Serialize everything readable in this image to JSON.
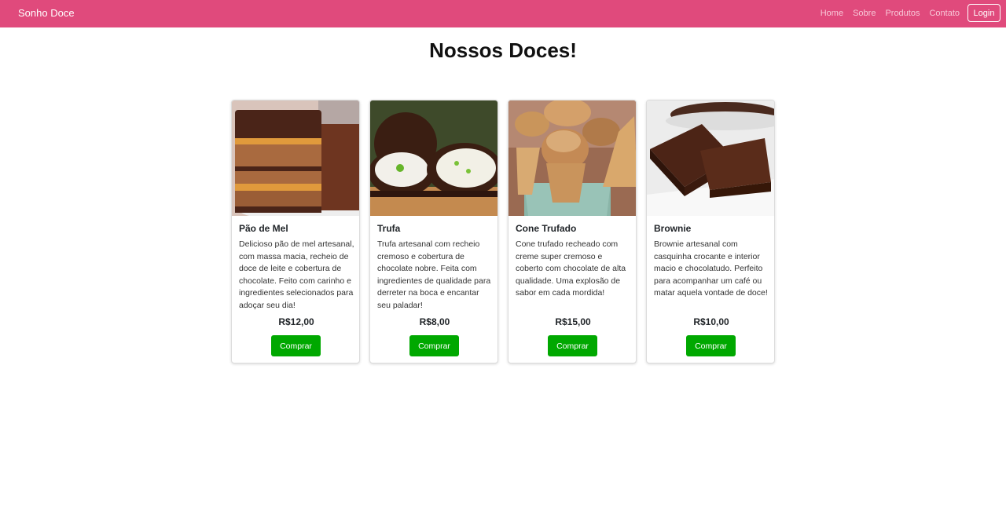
{
  "navbar": {
    "brand": "Sonho Doce",
    "links": [
      "Home",
      "Sobre",
      "Produtos",
      "Contato"
    ],
    "login_label": "Login"
  },
  "page": {
    "title": "Nossos Doces!"
  },
  "products": [
    {
      "name": "Pão de Mel",
      "description": "Delicioso pão de mel artesanal, com massa macia, recheio de doce de leite e cobertura de chocolate. Feito com carinho e ingredientes selecionados para adoçar seu dia!",
      "price": "R$12,00",
      "button": "Comprar"
    },
    {
      "name": "Trufa",
      "description": "Trufa artesanal com recheio cremoso e cobertura de chocolate nobre. Feita com ingredientes de qualidade para derreter na boca e encantar seu paladar!",
      "price": "R$8,00",
      "button": "Comprar"
    },
    {
      "name": "Cone Trufado",
      "description": "Cone trufado recheado com creme super cremoso e coberto com chocolate de alta qualidade. Uma explosão de sabor em cada mordida!",
      "price": "R$15,00",
      "button": "Comprar"
    },
    {
      "name": "Brownie",
      "description": "Brownie artesanal com casquinha crocante e interior macio e chocolatudo. Perfeito para acompanhar um café ou matar aquela vontade de doce!",
      "price": "R$10,00",
      "button": "Comprar"
    }
  ],
  "colors": {
    "navbar_bg": "#e04a7c",
    "buy_button": "#00a800"
  }
}
